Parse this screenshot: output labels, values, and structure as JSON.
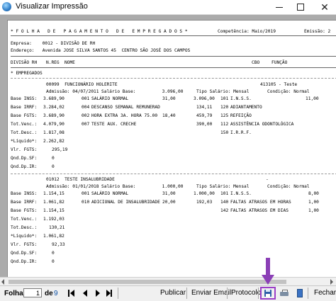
{
  "window": {
    "title": "Visualizar Impressão",
    "close_glyph": "✕"
  },
  "report": {
    "header_title": "* F O L H A   D E   P A G A M E N T O   D E   E M P R E G A D O S *",
    "competencia": "Competência: Maio/2019",
    "emissao": "Emissão: 2",
    "empresa": "Empresa:    0012 - DIVISÃO DE RH",
    "endereco": "Endereço:   Avenida JOSE SILVA SANTOS 45  CENTRO SÃO JOSÉ DOS CAMPOS",
    "col_headers": {
      "divisao": "DIVISÃO RH",
      "nreg": "N.REG",
      "nome": "NOME",
      "cbo": "CBO",
      "funcao": "FUNÇÃO"
    },
    "section_label": "* EMPREGADOS",
    "employees": [
      {
        "id_line": "00099  FUNCIONÁRIO HOLERITE",
        "cbo_line": "413105 - Teste",
        "admissao": "Admissão: 04/07/2011",
        "salario_base": "Salário Base:          3.096,00",
        "tipo_salario": "Tipo Salário: Mensal",
        "condicao": "Condição: Normal",
        "left_labels": [
          "Base INSS:",
          "Base IRRF:",
          "Base FGTS:",
          "Tot.Venc.:",
          "Tot.Desc.:",
          "*Líquido*:",
          "Vlr. FGTS:",
          "Qnd.Dp.SF:",
          "Qnd.Dp.IR:"
        ],
        "left_values": [
          "3.689,90",
          "3.284,02",
          "3.689,90",
          "4.079,90",
          "1.817,08",
          "2.262,82",
          "295,19",
          "0",
          "0"
        ],
        "proventos": [
          {
            "code": "001",
            "desc": "SALÁRIO NORMAL",
            "ref": "31,00",
            "val": "3.096,00"
          },
          {
            "code": "004",
            "desc": "DESCANSO SEMANAL REMUNERAD",
            "ref": "",
            "val": "134,11"
          },
          {
            "code": "002",
            "desc": "HORA EXTRA 3A. HORA 75.00",
            "ref": "18,40",
            "val": "459,79"
          },
          {
            "code": "007",
            "desc": "TESTE AUX. CRECHE",
            "ref": "",
            "val": "390,00"
          }
        ],
        "descontos": [
          {
            "code": "101",
            "desc": "I.N.S.S.",
            "ref": "11,00",
            "val": ""
          },
          {
            "code": "120",
            "desc": "ADIANTAMENTO",
            "ref": "",
            "val": ""
          },
          {
            "code": "125",
            "desc": "REFEIÇÃO",
            "ref": "",
            "val": ""
          },
          {
            "code": "112",
            "desc": "ASSISTÊNCIA ODONTOLÓGICA",
            "ref": "",
            "val": ""
          },
          {
            "code": "150",
            "desc": "I.R.R.F.",
            "ref": "",
            "val": ""
          }
        ]
      },
      {
        "id_line": "01012  TESTE INSALUBRIDADE",
        "cbo_line": "-",
        "admissao": "Admissão: 01/01/2018",
        "salario_base": "Salário Base:          1.000,00",
        "tipo_salario": "Tipo Salário: Mensal",
        "condicao": "Condição: Normal",
        "left_labels": [
          "Base INSS:",
          "Base IRRF:",
          "Base FGTS:",
          "Tot.Venc.:",
          "Tot.Desc.:",
          "*Líquido*:",
          "Vlr. FGTS:",
          "Qnd.Dp.SF:",
          "Qnd.Dp.IR:"
        ],
        "left_values": [
          "1.154,15",
          "1.061,82",
          "1.154,15",
          "1.192,03",
          "130,21",
          "1.061,82",
          "92,33",
          "0",
          "0"
        ],
        "proventos": [
          {
            "code": "001",
            "desc": "SALÁRIO NORMAL",
            "ref": "31,00",
            "val": "1.000,00"
          },
          {
            "code": "010",
            "desc": "ADICIONAL DE INSALUBRIDADE",
            "ref": "20,00",
            "val": "192,03"
          }
        ],
        "descontos": [
          {
            "code": "101",
            "desc": "I.N.S.S.",
            "ref": "8,00",
            "val": ""
          },
          {
            "code": "140",
            "desc": "FALTAS ATRASOS EM HORAS",
            "ref": "1,00",
            "val": ""
          },
          {
            "code": "142",
            "desc": "FALTAS ATRASOS EM DIAS",
            "ref": "1,00",
            "val": ""
          }
        ]
      }
    ]
  },
  "toolbar": {
    "page_label": "Folha",
    "page_value": "1",
    "of_label": "de",
    "total_pages": "9",
    "publish": "Publicar",
    "send_email": "Enviar Email",
    "protocol": "Protocolo",
    "close": "Fechar",
    "icons": [
      "first-page-icon",
      "prev-page-icon",
      "next-page-icon",
      "last-page-icon",
      "save-icon",
      "print-icon",
      "book-icon"
    ]
  },
  "annotation": {
    "arrow_color": "#8b3fb6",
    "highlight_color": "#9b3fc7"
  }
}
